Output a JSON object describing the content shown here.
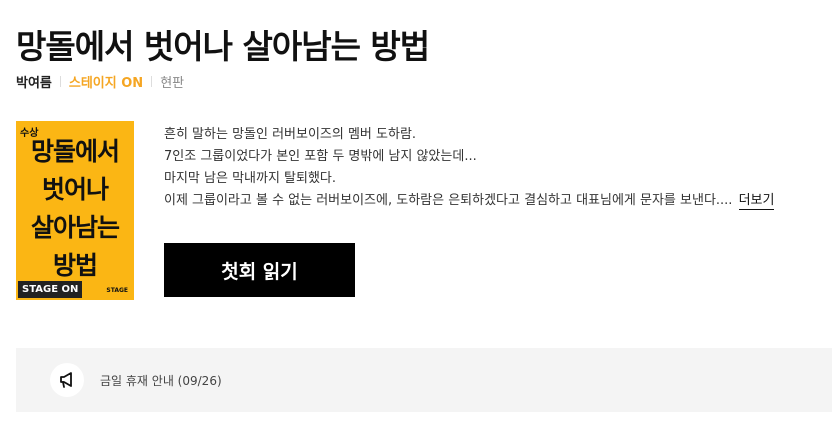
{
  "work": {
    "title": "망돌에서 벗어나 살아남는 방법",
    "author": "박여름",
    "platform": "스테이지 ON",
    "genre": "현판"
  },
  "cover": {
    "badge": "수상",
    "title": "망돌에서\n벗어나\n살아남는\n방법",
    "brand": "STAGE ON",
    "brand_small": "STAGE"
  },
  "synopsis": {
    "lines": [
      "흔히 말하는 망돌인 러버보이즈의 멤버 도하람.",
      "7인조 그룹이었다가 본인 포함 두 명밖에 남지 않았는데...",
      "마지막 남은 막내까지 탈퇴했다.",
      "이제 그룹이라고 볼 수 없는 러버보이즈에, 도하람은 은퇴하겠다고 결심하고 대표님에게 문자를 보낸다...."
    ],
    "more_label": "더보기"
  },
  "actions": {
    "read_first_label": "첫회 읽기"
  },
  "notice": {
    "icon": "megaphone-icon",
    "text": "금일 휴재 안내 (09/26)"
  }
}
